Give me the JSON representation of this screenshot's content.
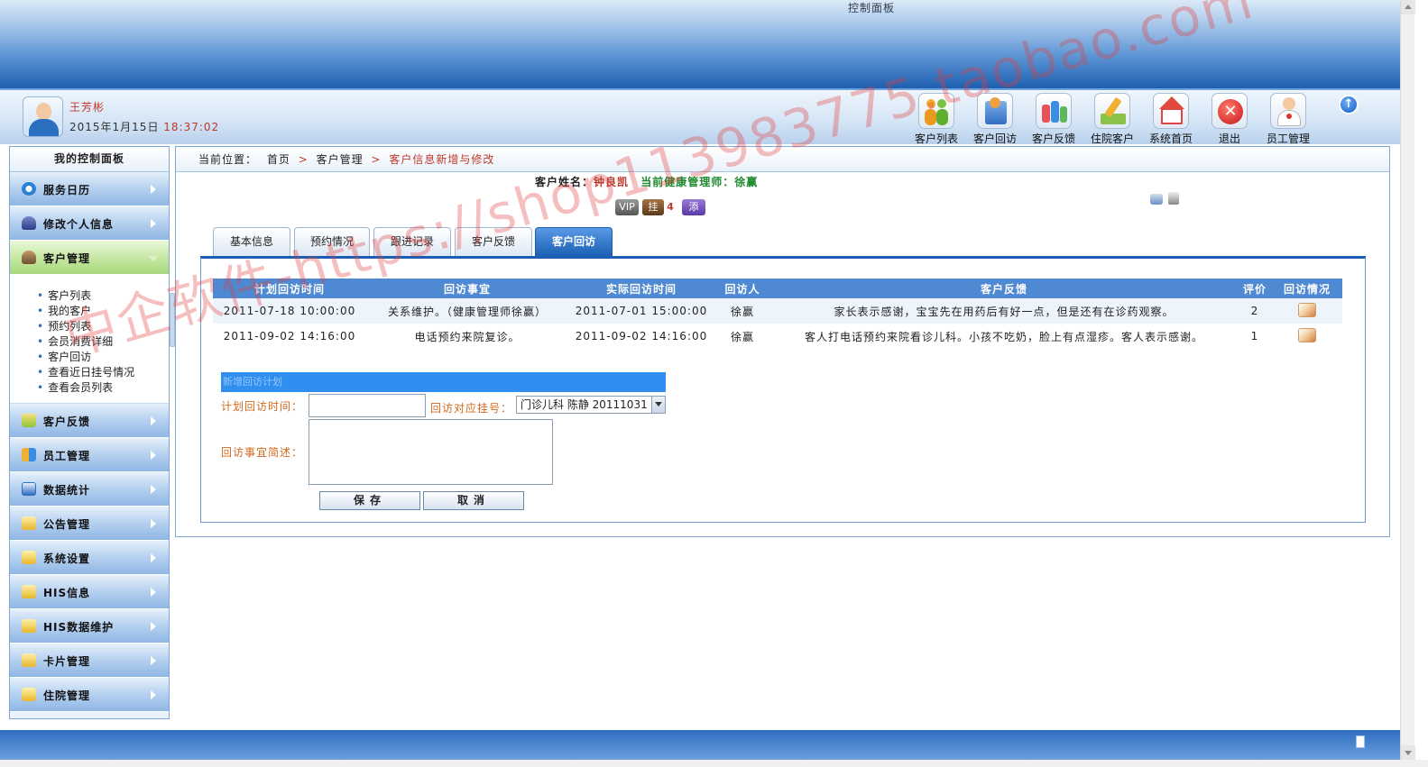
{
  "banner": {
    "title": "控制面板"
  },
  "user": {
    "name": "王芳彬",
    "date": "2015年1月15日",
    "time": "18:37:02"
  },
  "toolbar": [
    {
      "label": "客户列表",
      "icon": "people-icon"
    },
    {
      "label": "客户回访",
      "icon": "book-icon"
    },
    {
      "label": "客户反馈",
      "icon": "feedback-icon"
    },
    {
      "label": "住院客户",
      "icon": "pencil-icon"
    },
    {
      "label": "系统首页",
      "icon": "home-icon"
    },
    {
      "label": "退出",
      "icon": "close-icon"
    },
    {
      "label": "员工管理",
      "icon": "doctor-icon"
    }
  ],
  "sidebar": {
    "title": "我的控制面板",
    "menus": [
      {
        "label": "服务日历",
        "icon": "clock-icon"
      },
      {
        "label": "修改个人信息",
        "icon": "user-edit-icon"
      },
      {
        "label": "客户管理",
        "icon": "customer-icon"
      },
      {
        "label": "客户反馈",
        "icon": "feedback-icon"
      },
      {
        "label": "员工管理",
        "icon": "staff-icon"
      },
      {
        "label": "数据统计",
        "icon": "chart-icon"
      },
      {
        "label": "公告管理",
        "icon": "folder-icon"
      },
      {
        "label": "系统设置",
        "icon": "folder-icon"
      },
      {
        "label": "HIS信息",
        "icon": "folder-icon"
      },
      {
        "label": "HIS数据维护",
        "icon": "folder-icon"
      },
      {
        "label": "卡片管理",
        "icon": "folder-icon"
      },
      {
        "label": "住院管理",
        "icon": "folder-icon"
      }
    ],
    "submenu": [
      "客户列表",
      "我的客户",
      "预约列表",
      "会员消费详细",
      "客户回访",
      "查看近日挂号情况",
      "查看会员列表"
    ]
  },
  "breadcrumb": {
    "prefix": "当前位置：",
    "home": "首页",
    "section": "客户管理",
    "current": "客户信息新增与修改"
  },
  "customer": {
    "name_label": "客户姓名：",
    "name": "钟良凯",
    "manager": "当前健康管理师：徐赢"
  },
  "badges": {
    "vip": "VIP",
    "gua": "挂",
    "gua_count": "4",
    "add": "添"
  },
  "tabs": [
    "基本信息",
    "预约情况",
    "跟进记录",
    "客户反馈",
    "客户回访"
  ],
  "grid": {
    "headers": [
      "计划回访时间",
      "回访事宜",
      "实际回访时间",
      "回访人",
      "客户反馈",
      "评价",
      "回访情况"
    ],
    "rows": [
      [
        "2011-07-18 10:00:00",
        "关系维护。（健康管理师徐赢）",
        "2011-07-01 15:00:00",
        "徐赢",
        "家长表示感谢，宝宝先在用药后有好一点，但是还有在诊药观察。",
        "2"
      ],
      [
        "2011-09-02 14:16:00",
        "电话预约来院复诊。",
        "2011-09-02 14:16:00",
        "徐赢",
        "客人打电话预约来院看诊儿科。小孩不吃奶，脸上有点湿疹。客人表示感谢。",
        "1"
      ]
    ]
  },
  "form": {
    "header": "新增回访计划",
    "plan_time_label": "计划回访时间：",
    "plan_time_value": "",
    "reg_label": "回访对应挂号：",
    "reg_value": "门诊儿科 陈静 20111031",
    "desc_label": "回访事宜简述：",
    "save": "保存",
    "cancel": "取消"
  },
  "watermark": "中企软件-https://shop113983775.taobao.com"
}
